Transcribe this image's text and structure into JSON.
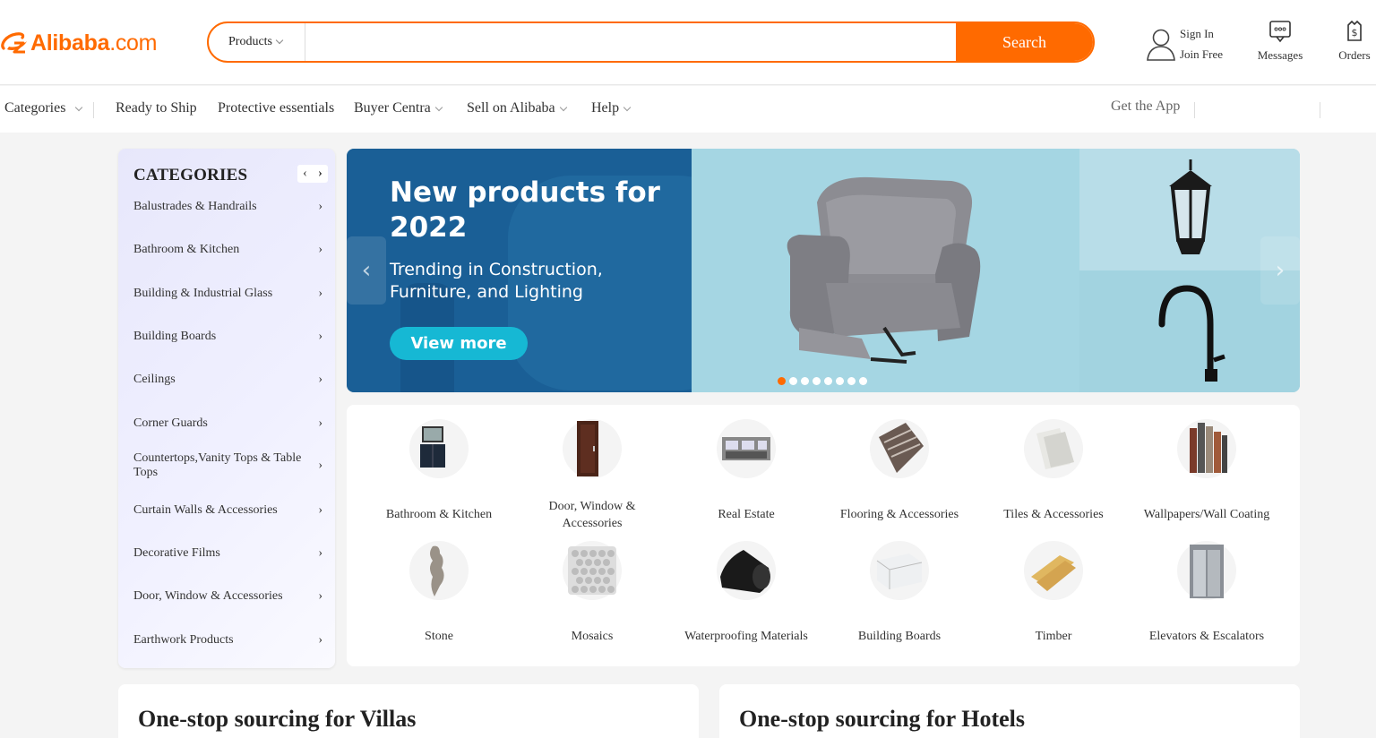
{
  "brand": {
    "name": "Alibaba",
    "suffix": ".com",
    "accent": "#ff6a00"
  },
  "search": {
    "category": "Products",
    "placeholder": "",
    "button": "Search"
  },
  "header": {
    "sign_in": "Sign In",
    "join_free": "Join Free",
    "messages": "Messages",
    "orders": "Orders"
  },
  "nav": {
    "categories": "Categories",
    "ready_to_ship": "Ready to Ship",
    "protective": "Protective essentials",
    "buyer_central": "Buyer Centra",
    "sell": "Sell on Alibaba",
    "help": "Help",
    "get_app": "Get the App"
  },
  "categories": {
    "title": "CATEGORIES",
    "items": [
      "Balustrades & Handrails",
      "Bathroom & Kitchen",
      "Building & Industrial Glass",
      "Building Boards",
      "Ceilings",
      "Corner Guards",
      "Countertops,Vanity Tops & Table Tops",
      "Curtain Walls & Accessories",
      "Decorative Films",
      "Door, Window & Accessories",
      "Earthwork Products"
    ]
  },
  "banner": {
    "title": "New products for 2022",
    "subtitle": "Trending in Construction, Furniture, and Lighting",
    "button": "View more",
    "slide_count": 8,
    "active_slide": 1
  },
  "grid": {
    "items": [
      {
        "label": "Bathroom & Kitchen",
        "icon": "vanity-icon"
      },
      {
        "label": "Door, Window & Accessories",
        "icon": "door-icon"
      },
      {
        "label": "Real Estate",
        "icon": "house-icon"
      },
      {
        "label": "Flooring & Accessories",
        "icon": "flooring-icon"
      },
      {
        "label": "Tiles & Accessories",
        "icon": "tiles-icon"
      },
      {
        "label": "Wallpapers/Wall Coating",
        "icon": "wallpaper-icon"
      },
      {
        "label": "Stone",
        "icon": "stone-icon"
      },
      {
        "label": "Mosaics",
        "icon": "mosaic-icon"
      },
      {
        "label": "Waterproofing Materials",
        "icon": "roll-icon"
      },
      {
        "label": "Building Boards",
        "icon": "board-icon"
      },
      {
        "label": "Timber",
        "icon": "timber-icon"
      },
      {
        "label": "Elevators & Escalators",
        "icon": "elevator-icon"
      }
    ]
  },
  "cards": {
    "villas": "One-stop sourcing for Villas",
    "hotels": "One-stop sourcing for Hotels"
  }
}
